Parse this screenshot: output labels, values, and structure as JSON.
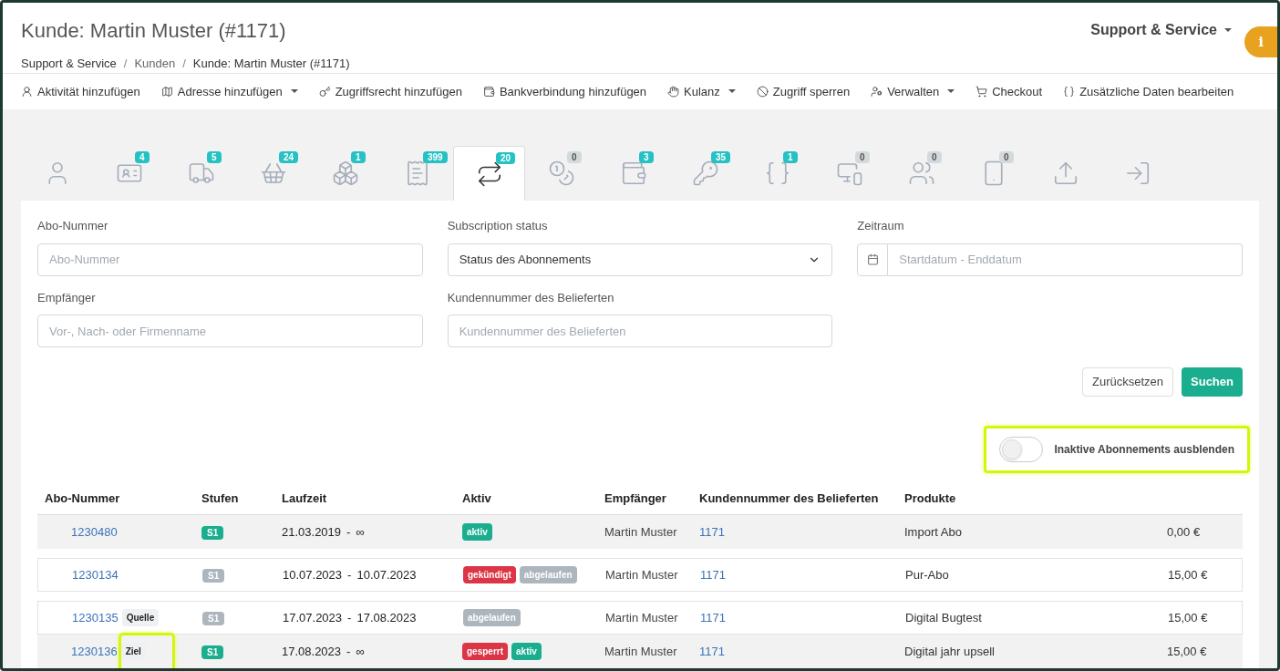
{
  "header": {
    "title": "Kunde: Martin Muster (#1171)",
    "breadcrumb": [
      "Support & Service",
      "Kunden",
      "Kunde: Martin Muster (#1171)"
    ],
    "breadcrumb_separator": "/",
    "area_menu": "Support & Service",
    "info_button": "i"
  },
  "toolbar": [
    {
      "label": "Aktivität hinzufügen",
      "dropdown": false
    },
    {
      "label": "Adresse hinzufügen",
      "dropdown": true
    },
    {
      "label": "Zugriffsrecht hinzufügen",
      "dropdown": false
    },
    {
      "label": "Bankverbindung hinzufügen",
      "dropdown": false
    },
    {
      "label": "Kulanz",
      "dropdown": true
    },
    {
      "label": "Zugriff sperren",
      "dropdown": false
    },
    {
      "label": "Verwalten",
      "dropdown": true
    },
    {
      "label": "Checkout",
      "dropdown": false
    },
    {
      "label": "Zusätzliche Daten bearbeiten",
      "dropdown": false
    }
  ],
  "tabs": [
    {
      "selected": false
    },
    {
      "count": "4",
      "color": "#25c1c3",
      "selected": false
    },
    {
      "count": "5",
      "color": "#25c1c3",
      "selected": false
    },
    {
      "count": "24",
      "color": "#25c1c3",
      "selected": false
    },
    {
      "count": "1",
      "color": "#25c1c3",
      "selected": false
    },
    {
      "count": "399",
      "color": "#25c1c3",
      "selected": false
    },
    {
      "count": "20",
      "color": "#25c1c3",
      "selected": true
    },
    {
      "count": "0",
      "color": "#d3d9dc",
      "selected": false
    },
    {
      "count": "3",
      "color": "#25c1c3",
      "selected": false
    },
    {
      "count": "35",
      "color": "#25c1c3",
      "selected": false
    },
    {
      "count": "1",
      "color": "#25c1c3",
      "selected": false
    },
    {
      "count": "0",
      "color": "#d3d9dc",
      "selected": false
    },
    {
      "count": "0",
      "color": "#d3d9dc",
      "selected": false
    },
    {
      "count": "0",
      "color": "#d3d9dc",
      "selected": false
    },
    {
      "selected": false
    },
    {
      "selected": false
    }
  ],
  "filters": [
    {
      "kind": "text",
      "label": "Abo-Nummer",
      "placeholder": "Abo-Nummer"
    },
    {
      "kind": "select",
      "label": "Subscription status",
      "value": "Status des Abonnements"
    },
    {
      "kind": "date",
      "label": "Zeitraum",
      "placeholder": "Startdatum - Enddatum"
    },
    {
      "kind": "text",
      "label": "Empfänger",
      "placeholder": "Vor-, Nach- oder Firmenname"
    },
    {
      "kind": "text",
      "label": "Kundennummer des Belieferten",
      "placeholder": "Kundennummer des Belieferten"
    }
  ],
  "buttons": {
    "reset": "Zurücksetzen",
    "search": "Suchen"
  },
  "toggle": {
    "label": "Inaktive Abonnements ausblenden",
    "on": false
  },
  "table": {
    "range_separator": "-",
    "columns": [
      "Abo-Nummer",
      "Stufen",
      "Laufzeit",
      "Aktiv",
      "Empfänger",
      "Kundennummer des Belieferten",
      "Produkte"
    ],
    "rows": [
      {
        "abo": "1230480",
        "stufe": {
          "label": "S1",
          "color": "#1aae8f"
        },
        "start": "21.03.2019",
        "end": "∞",
        "status": [
          {
            "label": "aktiv",
            "color": "#1aae8f"
          }
        ],
        "recipient": "Martin Muster",
        "customer_no": "1171",
        "product": "Import Abo",
        "price": "0,00 €",
        "shaded": true,
        "group_start": true
      },
      {
        "abo": "1230134",
        "stufe": {
          "label": "S1",
          "color": "#adb5bd"
        },
        "start": "10.07.2023",
        "end": "10.07.2023",
        "status": [
          {
            "label": "gekündigt",
            "color": "#dc3545"
          },
          {
            "label": "abgelaufen",
            "color": "#adb5bd"
          }
        ],
        "recipient": "Martin Muster",
        "customer_no": "1171",
        "product": "Pur-Abo",
        "price": "15,00 €",
        "shaded": false,
        "group_start": true
      },
      {
        "abo": "1230135",
        "tag": "Quelle",
        "stufe": {
          "label": "S1",
          "color": "#adb5bd"
        },
        "start": "17.07.2023",
        "end": "17.08.2023",
        "status": [
          {
            "label": "abgelaufen",
            "color": "#adb5bd"
          }
        ],
        "recipient": "Martin Muster",
        "customer_no": "1171",
        "product": "Digital Bugtest",
        "price": "15,00 €",
        "shaded": false,
        "group_start": true
      },
      {
        "abo": "1230136",
        "tag": "Ziel",
        "stufe": {
          "label": "S1",
          "color": "#1aae8f"
        },
        "start": "17.08.2023",
        "end": "∞",
        "status": [
          {
            "label": "gesperrt",
            "color": "#dc3545"
          },
          {
            "label": "aktiv",
            "color": "#1aae8f"
          }
        ],
        "recipient": "Martin Muster",
        "customer_no": "1171",
        "product": "Digital jahr upsell",
        "price": "15,00 €",
        "shaded": true,
        "group_start": false
      }
    ]
  }
}
